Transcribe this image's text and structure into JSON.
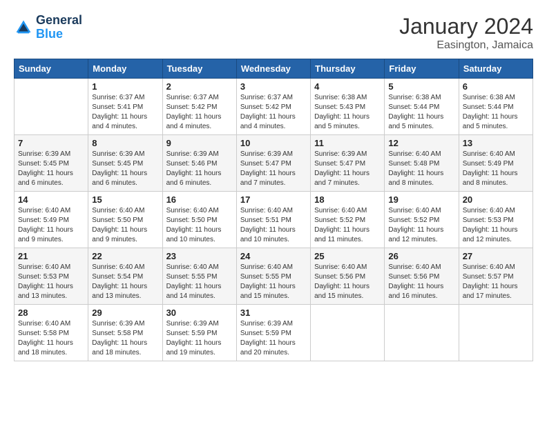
{
  "header": {
    "logo_line1": "General",
    "logo_line2": "Blue",
    "month": "January 2024",
    "location": "Easington, Jamaica"
  },
  "weekdays": [
    "Sunday",
    "Monday",
    "Tuesday",
    "Wednesday",
    "Thursday",
    "Friday",
    "Saturday"
  ],
  "weeks": [
    [
      {
        "day": "",
        "sunrise": "",
        "sunset": "",
        "daylight": ""
      },
      {
        "day": "1",
        "sunrise": "6:37 AM",
        "sunset": "5:41 PM",
        "daylight": "11 hours and 4 minutes."
      },
      {
        "day": "2",
        "sunrise": "6:37 AM",
        "sunset": "5:42 PM",
        "daylight": "11 hours and 4 minutes."
      },
      {
        "day": "3",
        "sunrise": "6:37 AM",
        "sunset": "5:42 PM",
        "daylight": "11 hours and 4 minutes."
      },
      {
        "day": "4",
        "sunrise": "6:38 AM",
        "sunset": "5:43 PM",
        "daylight": "11 hours and 5 minutes."
      },
      {
        "day": "5",
        "sunrise": "6:38 AM",
        "sunset": "5:44 PM",
        "daylight": "11 hours and 5 minutes."
      },
      {
        "day": "6",
        "sunrise": "6:38 AM",
        "sunset": "5:44 PM",
        "daylight": "11 hours and 5 minutes."
      }
    ],
    [
      {
        "day": "7",
        "sunrise": "6:39 AM",
        "sunset": "5:45 PM",
        "daylight": "11 hours and 6 minutes."
      },
      {
        "day": "8",
        "sunrise": "6:39 AM",
        "sunset": "5:45 PM",
        "daylight": "11 hours and 6 minutes."
      },
      {
        "day": "9",
        "sunrise": "6:39 AM",
        "sunset": "5:46 PM",
        "daylight": "11 hours and 6 minutes."
      },
      {
        "day": "10",
        "sunrise": "6:39 AM",
        "sunset": "5:47 PM",
        "daylight": "11 hours and 7 minutes."
      },
      {
        "day": "11",
        "sunrise": "6:39 AM",
        "sunset": "5:47 PM",
        "daylight": "11 hours and 7 minutes."
      },
      {
        "day": "12",
        "sunrise": "6:40 AM",
        "sunset": "5:48 PM",
        "daylight": "11 hours and 8 minutes."
      },
      {
        "day": "13",
        "sunrise": "6:40 AM",
        "sunset": "5:49 PM",
        "daylight": "11 hours and 8 minutes."
      }
    ],
    [
      {
        "day": "14",
        "sunrise": "6:40 AM",
        "sunset": "5:49 PM",
        "daylight": "11 hours and 9 minutes."
      },
      {
        "day": "15",
        "sunrise": "6:40 AM",
        "sunset": "5:50 PM",
        "daylight": "11 hours and 9 minutes."
      },
      {
        "day": "16",
        "sunrise": "6:40 AM",
        "sunset": "5:50 PM",
        "daylight": "11 hours and 10 minutes."
      },
      {
        "day": "17",
        "sunrise": "6:40 AM",
        "sunset": "5:51 PM",
        "daylight": "11 hours and 10 minutes."
      },
      {
        "day": "18",
        "sunrise": "6:40 AM",
        "sunset": "5:52 PM",
        "daylight": "11 hours and 11 minutes."
      },
      {
        "day": "19",
        "sunrise": "6:40 AM",
        "sunset": "5:52 PM",
        "daylight": "11 hours and 12 minutes."
      },
      {
        "day": "20",
        "sunrise": "6:40 AM",
        "sunset": "5:53 PM",
        "daylight": "11 hours and 12 minutes."
      }
    ],
    [
      {
        "day": "21",
        "sunrise": "6:40 AM",
        "sunset": "5:53 PM",
        "daylight": "11 hours and 13 minutes."
      },
      {
        "day": "22",
        "sunrise": "6:40 AM",
        "sunset": "5:54 PM",
        "daylight": "11 hours and 13 minutes."
      },
      {
        "day": "23",
        "sunrise": "6:40 AM",
        "sunset": "5:55 PM",
        "daylight": "11 hours and 14 minutes."
      },
      {
        "day": "24",
        "sunrise": "6:40 AM",
        "sunset": "5:55 PM",
        "daylight": "11 hours and 15 minutes."
      },
      {
        "day": "25",
        "sunrise": "6:40 AM",
        "sunset": "5:56 PM",
        "daylight": "11 hours and 15 minutes."
      },
      {
        "day": "26",
        "sunrise": "6:40 AM",
        "sunset": "5:56 PM",
        "daylight": "11 hours and 16 minutes."
      },
      {
        "day": "27",
        "sunrise": "6:40 AM",
        "sunset": "5:57 PM",
        "daylight": "11 hours and 17 minutes."
      }
    ],
    [
      {
        "day": "28",
        "sunrise": "6:40 AM",
        "sunset": "5:58 PM",
        "daylight": "11 hours and 18 minutes."
      },
      {
        "day": "29",
        "sunrise": "6:39 AM",
        "sunset": "5:58 PM",
        "daylight": "11 hours and 18 minutes."
      },
      {
        "day": "30",
        "sunrise": "6:39 AM",
        "sunset": "5:59 PM",
        "daylight": "11 hours and 19 minutes."
      },
      {
        "day": "31",
        "sunrise": "6:39 AM",
        "sunset": "5:59 PM",
        "daylight": "11 hours and 20 minutes."
      },
      {
        "day": "",
        "sunrise": "",
        "sunset": "",
        "daylight": ""
      },
      {
        "day": "",
        "sunrise": "",
        "sunset": "",
        "daylight": ""
      },
      {
        "day": "",
        "sunrise": "",
        "sunset": "",
        "daylight": ""
      }
    ]
  ],
  "labels": {
    "sunrise_prefix": "Sunrise: ",
    "sunset_prefix": "Sunset: ",
    "daylight_prefix": "Daylight: "
  }
}
